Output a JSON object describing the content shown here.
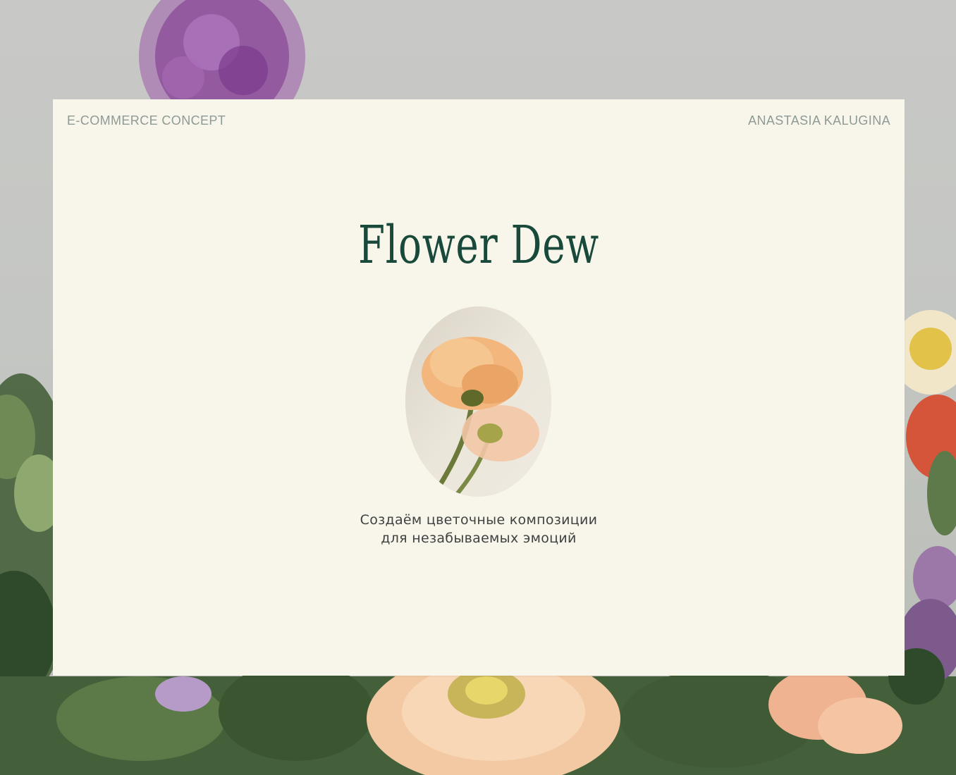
{
  "header": {
    "left_label": "E-COMMERCE CONCEPT",
    "right_label": "ANASTASIA KALUGINA"
  },
  "hero": {
    "title": "Flower Dew",
    "tagline_line1": "Создаём цветочные композиции",
    "tagline_line2": "для незабываемых эмоций"
  },
  "colors": {
    "card_background": "#f8f6ea",
    "brand_green": "#18493a",
    "corner_text": "#8e9a95",
    "tagline_text": "#3f4240",
    "page_background": "#c6c7c4"
  },
  "images": {
    "background": "flower-bouquet-photo",
    "hero": "peach-poppy-photo"
  }
}
